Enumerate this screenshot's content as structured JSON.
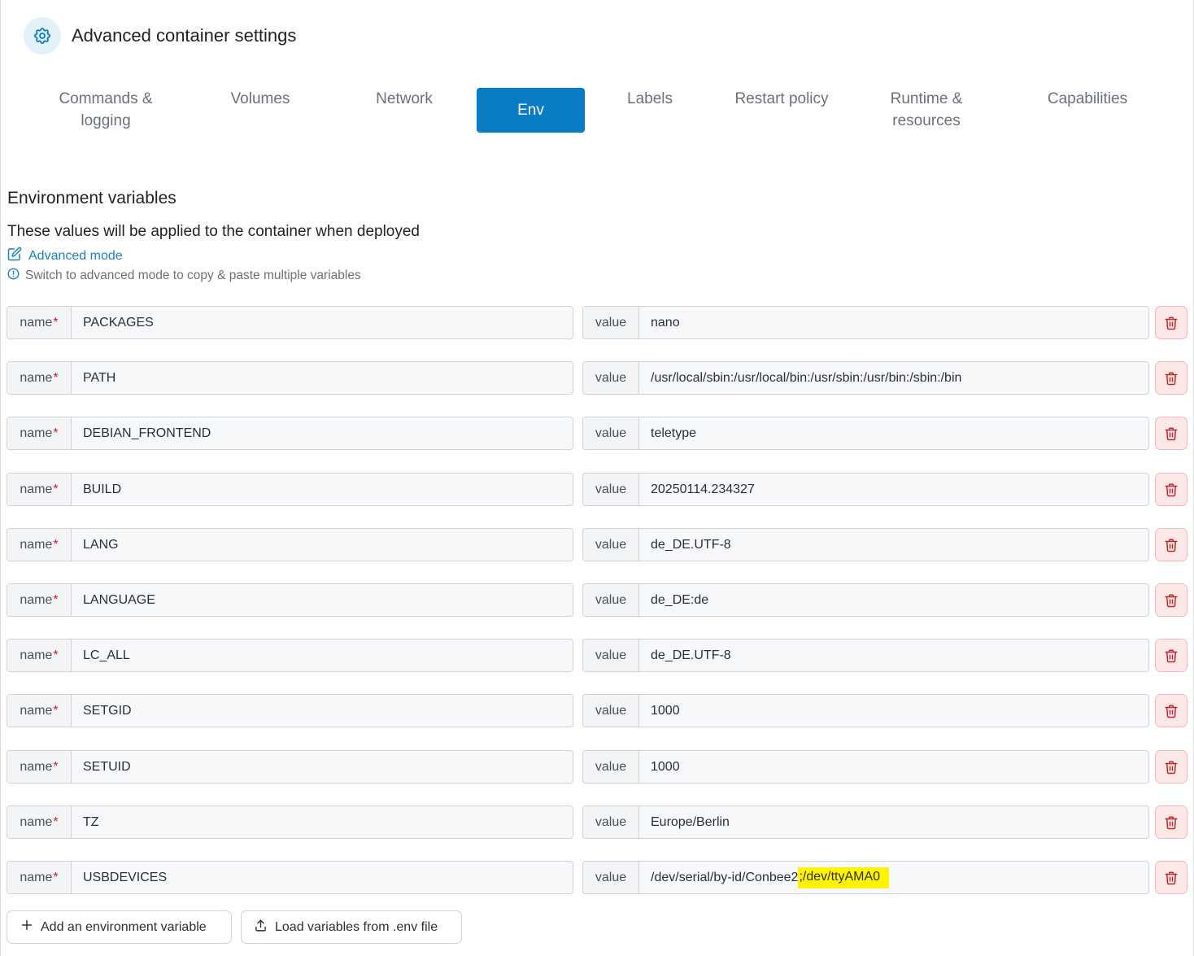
{
  "header": {
    "title": "Advanced container settings",
    "icon": "gear-icon"
  },
  "tabs": [
    {
      "label": "Commands &\nlogging",
      "active": false
    },
    {
      "label": "Volumes",
      "active": false
    },
    {
      "label": "Network",
      "active": false
    },
    {
      "label": "Env",
      "active": true
    },
    {
      "label": "Labels",
      "active": false
    },
    {
      "label": "Restart policy",
      "active": false
    },
    {
      "label": "Runtime &\nresources",
      "active": false
    },
    {
      "label": "Capabilities",
      "active": false
    }
  ],
  "section": {
    "title": "Environment variables",
    "description": "These values will be applied to the container when deployed",
    "advanced_mode_label": "Advanced mode",
    "hint": "Switch to advanced mode to copy & paste multiple variables"
  },
  "labels": {
    "name": "name",
    "required_marker": "*",
    "value": "value"
  },
  "env_vars": [
    {
      "name": "PACKAGES",
      "value": "nano"
    },
    {
      "name": "PATH",
      "value": "/usr/local/sbin:/usr/local/bin:/usr/sbin:/usr/bin:/sbin:/bin"
    },
    {
      "name": "DEBIAN_FRONTEND",
      "value": "teletype"
    },
    {
      "name": "BUILD",
      "value": "20250114.234327"
    },
    {
      "name": "LANG",
      "value": "de_DE.UTF-8"
    },
    {
      "name": "LANGUAGE",
      "value": "de_DE:de"
    },
    {
      "name": "LC_ALL",
      "value": "de_DE.UTF-8"
    },
    {
      "name": "SETGID",
      "value": "1000"
    },
    {
      "name": "SETUID",
      "value": "1000"
    },
    {
      "name": "TZ",
      "value": "Europe/Berlin"
    },
    {
      "name": "USBDEVICES",
      "value": "/dev/serial/by-id/Conbee2",
      "value_highlighted": ";/dev/ttyAMA0"
    }
  ],
  "buttons": {
    "add": "Add an environment variable",
    "load": "Load variables from .env file"
  },
  "colors": {
    "accent": "#0a7cc6",
    "danger": "#c0262d",
    "highlight": "#fff400"
  }
}
